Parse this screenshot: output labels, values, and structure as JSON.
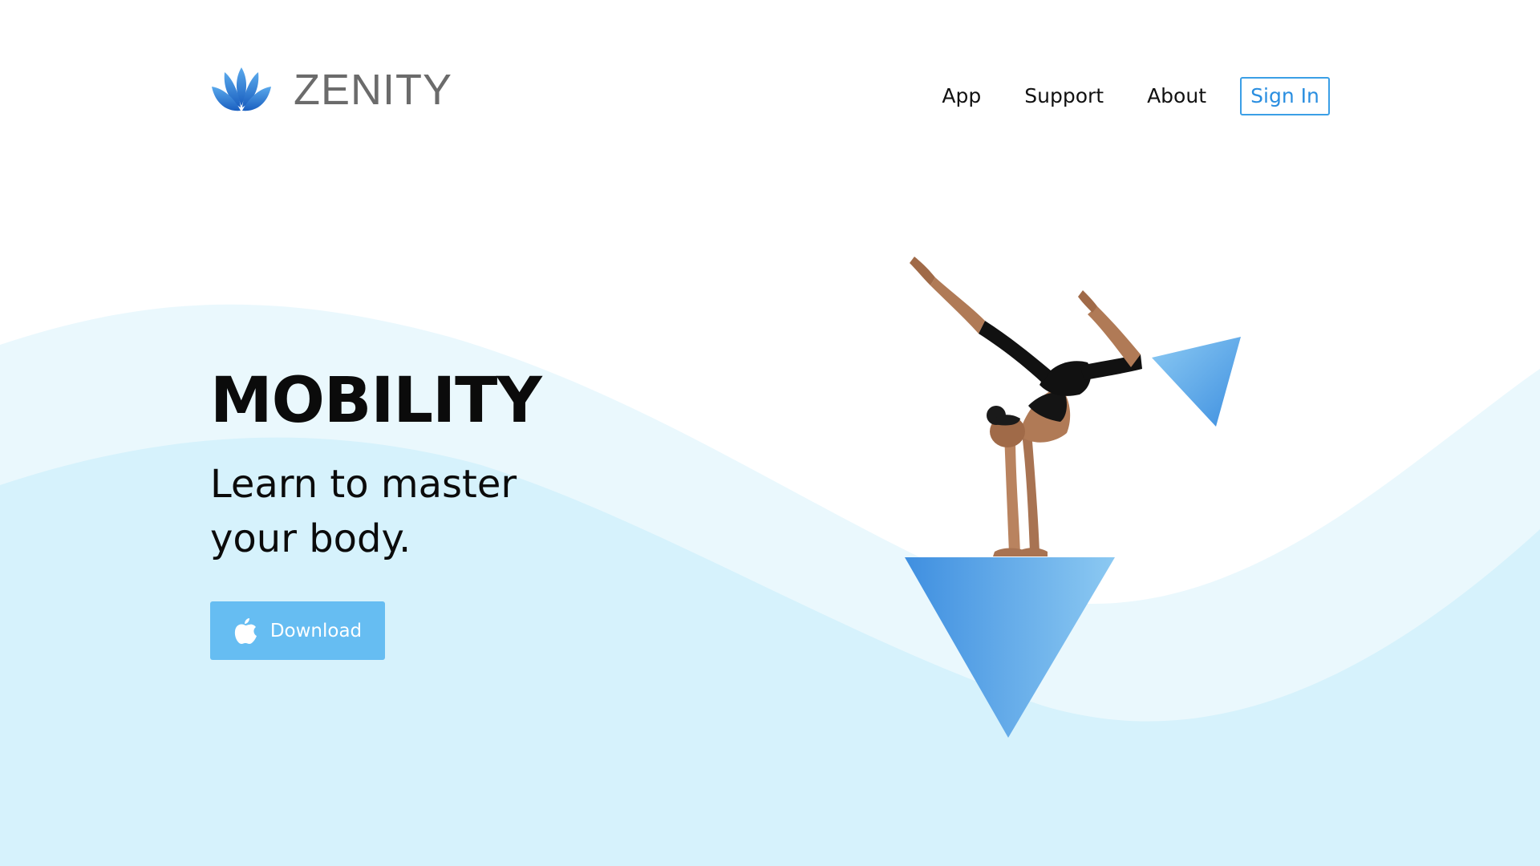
{
  "brand": {
    "name": "ZENITY",
    "logo_icon": "lotus-icon"
  },
  "nav": {
    "items": [
      {
        "label": "App"
      },
      {
        "label": "Support"
      },
      {
        "label": "About"
      }
    ],
    "sign_in_label": "Sign In"
  },
  "hero": {
    "title": "MOBILITY",
    "subtitle": "Learn to master your body.",
    "download_label": "Download",
    "download_icon": "apple-icon"
  },
  "colors": {
    "accent": "#3b9fe6",
    "button": "#66bdf2",
    "wave_light": "#eaf8fd",
    "wave_base": "#d6f2fc"
  }
}
